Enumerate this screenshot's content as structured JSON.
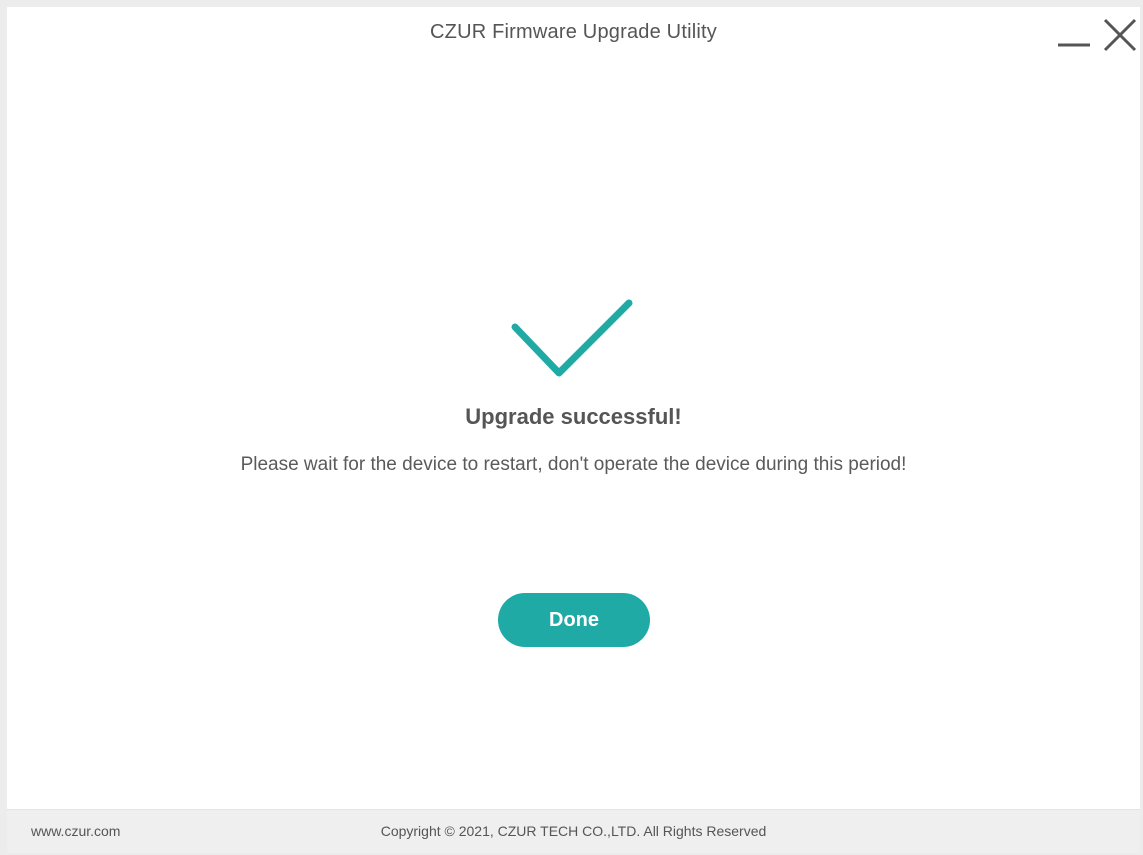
{
  "window": {
    "title": "CZUR Firmware Upgrade Utility"
  },
  "controls": {
    "minimize_icon": "minimize-icon",
    "close_icon": "close-icon"
  },
  "status": {
    "icon": "checkmark-icon",
    "title": "Upgrade successful!",
    "message": "Please wait for the device to restart, don't operate the device during this period!"
  },
  "actions": {
    "done_label": "Done"
  },
  "footer": {
    "website": "www.czur.com",
    "copyright": "Copyright © 2021, CZUR TECH CO.,LTD. All Rights Reserved"
  },
  "colors": {
    "accent": "#1faaa6",
    "text": "#555555",
    "footer_bg": "#efefef"
  }
}
